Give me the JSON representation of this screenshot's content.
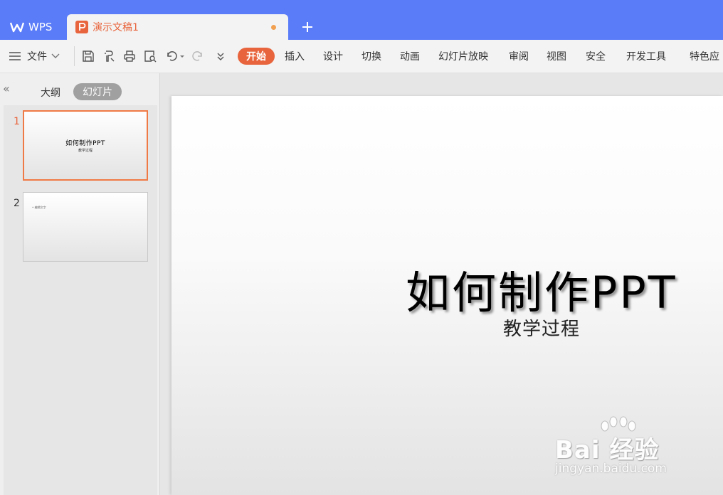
{
  "titlebar": {
    "app_label": "WPS",
    "doc_tab_name": "演示文稿1"
  },
  "toolbar": {
    "file_label": "文件",
    "tabs": [
      "开始",
      "插入",
      "设计",
      "切换",
      "动画",
      "幻灯片放映",
      "审阅",
      "视图",
      "安全",
      "开发工具",
      "特色应"
    ],
    "active_tab": "开始"
  },
  "sidepanel": {
    "tab_outline": "大纲",
    "tab_slides": "幻灯片",
    "thumbnails": [
      {
        "number": "1",
        "title": "如何制作PPT",
        "subtitle": "教学过程"
      },
      {
        "number": "2",
        "bullet": "• 编辑文字"
      }
    ]
  },
  "slide": {
    "title": "如何制作PPT",
    "subtitle": "教学过程"
  },
  "watermark": {
    "brand": "Bai 经验",
    "url": "jingyan.baidu.com"
  },
  "colors": {
    "titlebar": "#5a7cf8",
    "accent": "#e8643c",
    "selected_border": "#f07a45"
  }
}
